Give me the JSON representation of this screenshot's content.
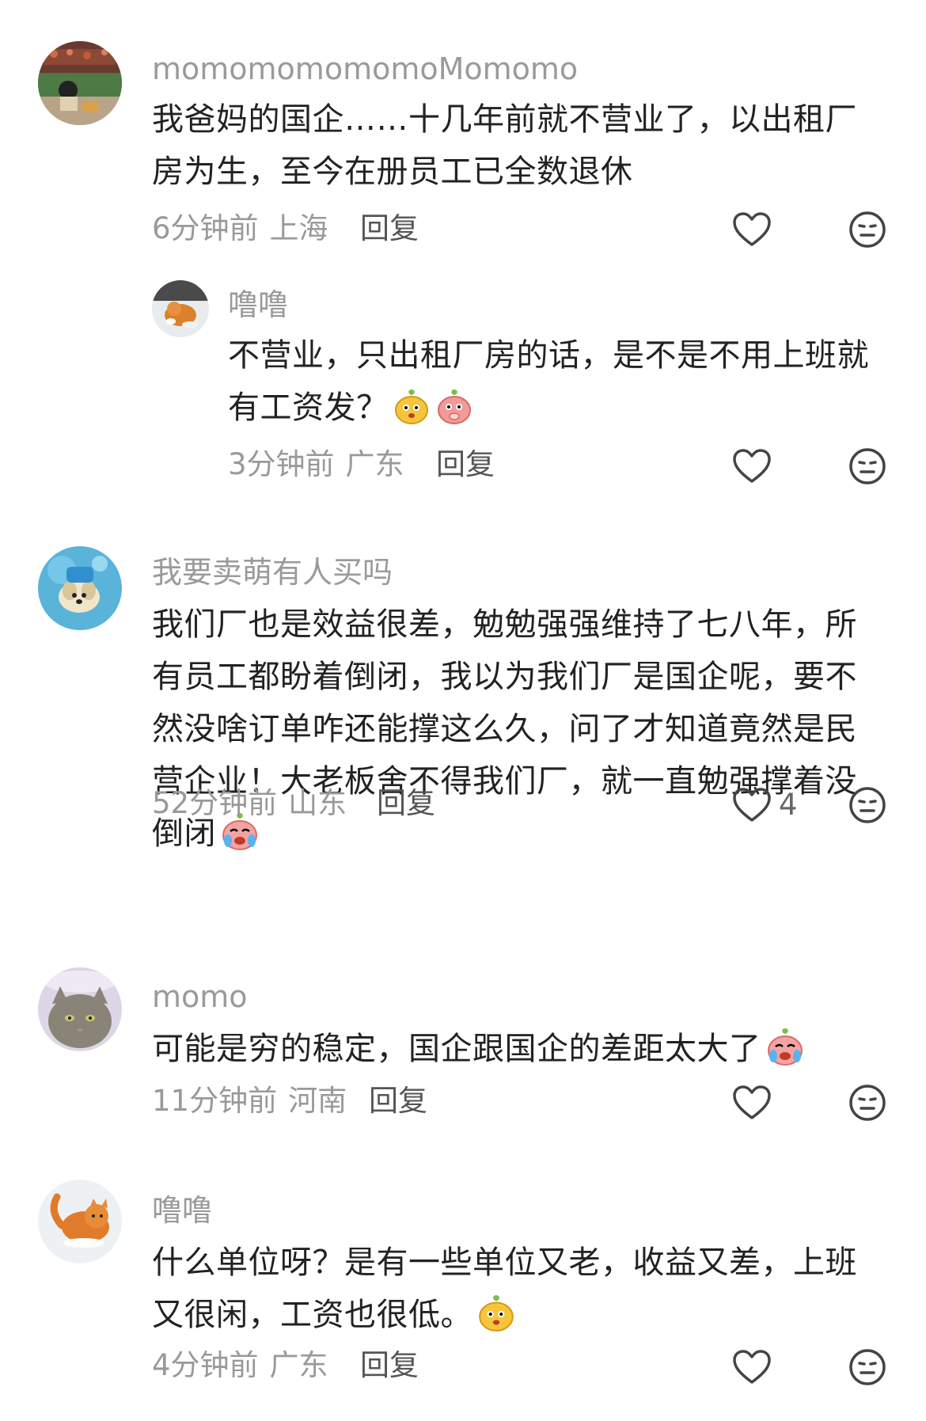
{
  "comments": [
    {
      "username": "momomomomomoMomomo",
      "text": "我爸妈的国企……十几年前就不营业了，以出租厂房为生，至今在册员工已全数退休",
      "time": "6分钟前",
      "location": "上海",
      "reply_label": "回复",
      "likes": ""
    },
    {
      "username": "噜噜",
      "text": "不营业，只出租厂房的话，是不是不用上班就有工资发？",
      "time": "3分钟前",
      "location": "广东",
      "reply_label": "回复",
      "likes": ""
    },
    {
      "username": "我要卖萌有人买吗",
      "text": "我们厂也是效益很差，勉勉强强维持了七八年，所有员工都盼着倒闭，我以为我们厂是国企呢，要不然没啥订单咋还能撑这么久，问了才知道竟然是民营企业！大老板舍不得我们厂，就一直勉强撑着没倒闭",
      "time": "52分钟前",
      "location": "山东",
      "reply_label": "回复",
      "likes": "4"
    },
    {
      "username": "momo",
      "text": "可能是穷的稳定，国企跟国企的差距太大了",
      "time": "11分钟前",
      "location": "河南",
      "reply_label": "回复",
      "likes": ""
    },
    {
      "username": "噜噜",
      "text": "什么单位呀？是有一些单位又老，收益又差，上班又很闲，工资也很低。",
      "time": "4分钟前",
      "location": "广东",
      "reply_label": "回复",
      "likes": ""
    }
  ],
  "icons": {
    "like": "heart-outline-icon",
    "dislike": "neutral-face-icon",
    "emoji_sticker_yellow": "yellow-smiling-emoji",
    "emoji_sticker_pink": "pink-shy-emoji",
    "emoji_sticker_crying": "crying-emoji"
  },
  "colors": {
    "username": "#9a9a9a",
    "text": "#222222",
    "meta": "#999999",
    "icon": "#444444"
  }
}
